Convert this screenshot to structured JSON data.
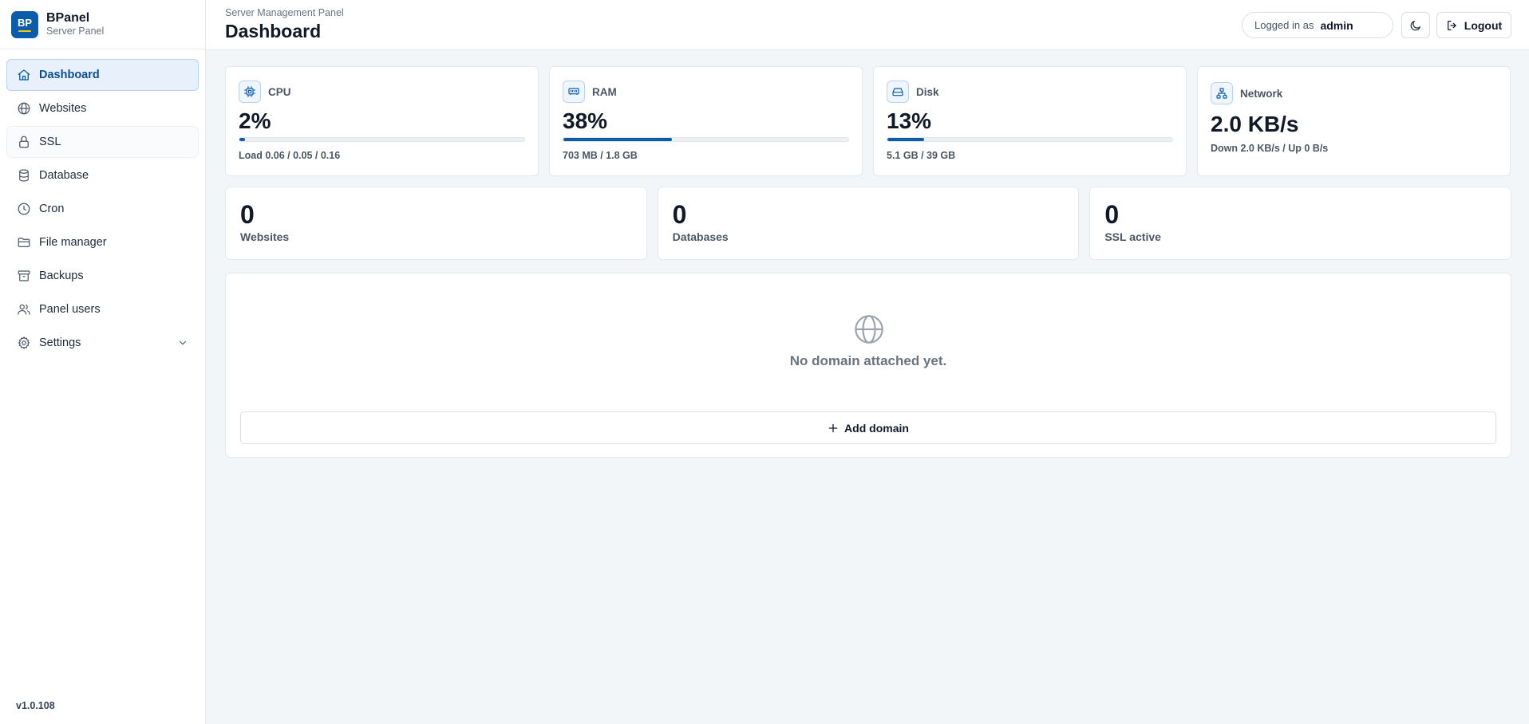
{
  "brand": {
    "logo_text": "BP",
    "name": "BPanel",
    "subtitle": "Server Panel"
  },
  "sidebar": {
    "items": [
      {
        "label": "Dashboard",
        "icon": "home-icon"
      },
      {
        "label": "Websites",
        "icon": "globe-icon"
      },
      {
        "label": "SSL",
        "icon": "lock-icon"
      },
      {
        "label": "Database",
        "icon": "database-icon"
      },
      {
        "label": "Cron",
        "icon": "clock-icon"
      },
      {
        "label": "File manager",
        "icon": "folder-icon"
      },
      {
        "label": "Backups",
        "icon": "archive-icon"
      },
      {
        "label": "Panel users",
        "icon": "users-icon"
      },
      {
        "label": "Settings",
        "icon": "gear-icon"
      }
    ],
    "active": "Dashboard",
    "version": "v1.0.108"
  },
  "header": {
    "subtitle": "Server Management Panel",
    "title": "Dashboard",
    "logged_in_label": "Logged in as",
    "username": "admin",
    "logout_label": "Logout"
  },
  "stats": {
    "cpu": {
      "label": "CPU",
      "value": "2%",
      "percent": 2,
      "sub": "Load 0.06 / 0.05 / 0.16"
    },
    "ram": {
      "label": "RAM",
      "value": "38%",
      "percent": 38,
      "sub": "703 MB / 1.8 GB"
    },
    "disk": {
      "label": "Disk",
      "value": "13%",
      "percent": 13,
      "sub": "5.1 GB / 39 GB"
    },
    "network": {
      "label": "Network",
      "value": "2.0 KB/s",
      "sub": "Down 2.0 KB/s / Up 0 B/s"
    }
  },
  "counts": {
    "websites": {
      "value": "0",
      "label": "Websites"
    },
    "databases": {
      "value": "0",
      "label": "Databases"
    },
    "ssl": {
      "value": "0",
      "label": "SSL active"
    }
  },
  "domains": {
    "empty_text": "No domain attached yet.",
    "add_label": "Add domain"
  },
  "colors": {
    "accent": "#0b5cab",
    "accent_light": "#e8f1fb",
    "background": "#f3f6f9"
  }
}
